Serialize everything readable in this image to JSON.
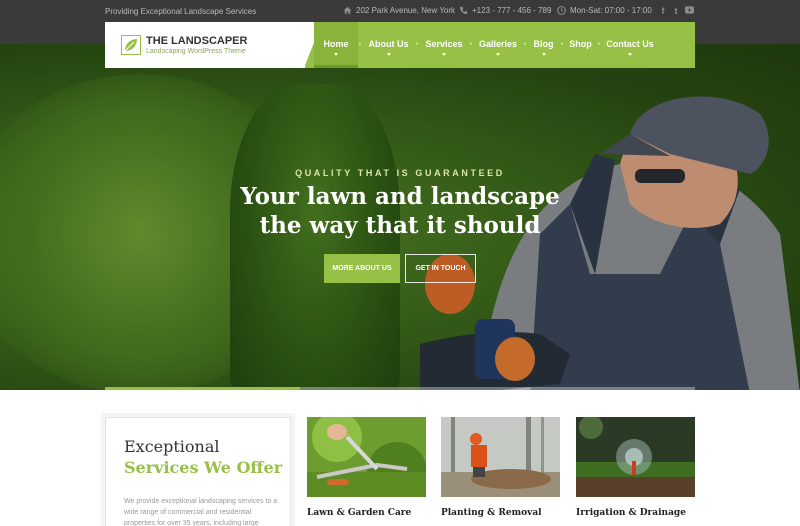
{
  "topbar": {
    "tagline": "Providing Exceptional Landscape Services",
    "address": "202 Park Avenue, New York",
    "phone": "+123 - 777 - 456 - 789",
    "hours": "Mon-Sat: 07:00 - 17:00",
    "social": [
      "f",
      "t",
      "yt"
    ]
  },
  "brand": {
    "title": "THE LANDSCAPER",
    "subtitle": "Landscaping WordPress Theme",
    "accent": "#97c046"
  },
  "nav": {
    "items": [
      {
        "label": "Home",
        "active": true
      },
      {
        "label": "About Us"
      },
      {
        "label": "Services"
      },
      {
        "label": "Galleries"
      },
      {
        "label": "Blog"
      },
      {
        "label": "Shop"
      },
      {
        "label": "Contact Us"
      }
    ]
  },
  "hero": {
    "kicker": "QUALITY THAT IS GUARANTEED",
    "title_line1": "Your lawn and landscape",
    "title_line2": "the way that it should",
    "btn_about": "MORE ABOUT US",
    "btn_touch": "GET IN TOUCH",
    "slider_progress": 0.33
  },
  "services_intro": {
    "line1": "Exceptional",
    "line2": "Services We Offer",
    "body": "We provide exceptional landscaping services to a wide range of commercial and residential properties for over 35 years, including large"
  },
  "cards": [
    {
      "title": "Lawn & Garden Care"
    },
    {
      "title": "Planting & Removal"
    },
    {
      "title": "Irrigation & Drainage"
    }
  ]
}
